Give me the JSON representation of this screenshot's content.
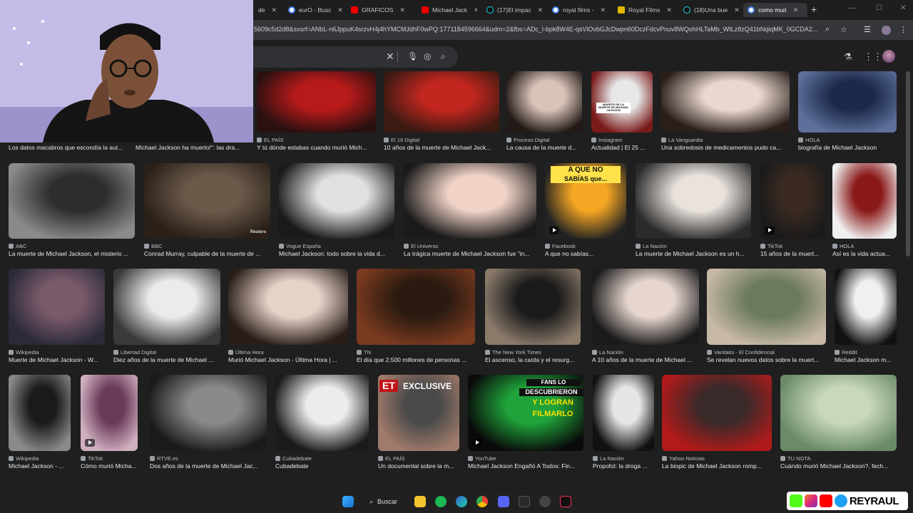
{
  "tabs": [
    {
      "label": "de",
      "color": "#c00"
    },
    {
      "label": "eurO - Busc",
      "color": "#4285f4"
    },
    {
      "label": "GRAFICOS",
      "color": "#e00"
    },
    {
      "label": "Michael Jack",
      "color": "#e00"
    },
    {
      "label": "(17)El impac",
      "color": "#111"
    },
    {
      "label": "royal films -",
      "color": "#4285f4"
    },
    {
      "label": "Royal Films",
      "color": "#e0b800"
    },
    {
      "label": "(18)Una bue",
      "color": "#111"
    },
    {
      "label": "como muri",
      "color": "#4285f4"
    }
  ],
  "address": {
    "url": "5609c5d2d8&sxsrf=ANbL-n6JppuK4srzvH4j4hYMCMJdhF0wPQ:1771184596664&udm=2&fbs=ADc_l-bpk8W4E-qsVlOvbGJcDwpn60DczFdcvPnuv8WQohHLTaMb_WtLz8zQ41bNqiqMK_0GCDA2..."
  },
  "results": [
    {
      "source": "",
      "title": "Los datos macabros que escondía la aut...",
      "colors": [
        "#2a2a2a",
        "#3a3a3a"
      ]
    },
    {
      "source": "",
      "title": "Michael Jackson ha muerto!\": las dra...",
      "colors": [
        "#333",
        "#555"
      ]
    },
    {
      "source": "EL PAÍS",
      "title": "Y tú dónde estabas cuando murió Mich...",
      "colors": [
        "#b81a1a",
        "#2a1010"
      ]
    },
    {
      "source": "El 19 Digital",
      "title": "10 años de la muerte de Michael Jack...",
      "colors": [
        "#c2261f",
        "#3b1a12"
      ]
    },
    {
      "source": "Proceso Digital",
      "title": "La causa de la muerte d...",
      "colors": [
        "#d9c3b8",
        "#231a18"
      ]
    },
    {
      "source": "Instagram",
      "title": "Actualidad | El 25 ...",
      "colors": [
        "#e8e8e8",
        "#7a1a1a"
      ]
    },
    {
      "source": "La Vanguardia",
      "title": "Una sobredosis de medicamentos pudo ca...",
      "colors": [
        "#e9d8cf",
        "#2a1e1a"
      ]
    },
    {
      "source": "HOLA",
      "title": "biografía de Michael Jackson",
      "colors": [
        "#1c2a4a",
        "#5d6f9a"
      ]
    },
    {
      "source": "ABC",
      "title": "La muerte de Michael Jackson, el misterio ...",
      "colors": [
        "#2d2d2d",
        "#8a8a8a"
      ]
    },
    {
      "source": "BBC",
      "title": "Conrad Murray, culpable de la muerte de ...",
      "colors": [
        "#6b5a4a",
        "#2a2018"
      ]
    },
    {
      "source": "Vogue España",
      "title": "Michael Jackson: todo sobre la vida d...",
      "colors": [
        "#e0e0e0",
        "#1a1a1a"
      ]
    },
    {
      "source": "El Universo",
      "title": "La trágica muerte de Michael Jackson fue \"in...",
      "colors": [
        "#f0d2c6",
        "#1a1a1a"
      ]
    },
    {
      "source": "Facebook",
      "title": "A que no sabías...",
      "colors": [
        "#f5a623",
        "#222"
      ],
      "play": true
    },
    {
      "source": "La Nación",
      "title": "La muerte de Michael Jackson es un h...",
      "colors": [
        "#e9e2dd",
        "#2a2a2a"
      ]
    },
    {
      "source": "TikTok",
      "title": "15 años de la muert...",
      "colors": [
        "#3a2a22",
        "#1a1a1a"
      ],
      "play": true
    },
    {
      "source": "HOLA",
      "title": "Así es la vida actua...",
      "colors": [
        "#8a1a1a",
        "#f0f0f0"
      ]
    },
    {
      "source": "Wikipedia",
      "title": "Muerte de Michael Jackson - W...",
      "colors": [
        "#7a5a6a",
        "#2a2a3a"
      ]
    },
    {
      "source": "Libertad Digital",
      "title": "Diez años de la muerte de Michael ...",
      "colors": [
        "#ebebeb",
        "#3a3a3a"
      ]
    },
    {
      "source": "Última Hora",
      "title": "Murió Michael Jackson - Última Hora | ...",
      "colors": [
        "#e5d3c8",
        "#2a1d18"
      ]
    },
    {
      "source": "TN",
      "title": "El día que 2.500 millones de personas ...",
      "colors": [
        "#2a1a10",
        "#7a3a20"
      ]
    },
    {
      "source": "The New York Times",
      "title": "El ascenso, la caída y el resurg...",
      "colors": [
        "#1a1a1a",
        "#8a7a6a"
      ]
    },
    {
      "source": "La Nación",
      "title": "A 10 años de la muerte de Michael ...",
      "colors": [
        "#e6d6cf",
        "#1a1a1a"
      ]
    },
    {
      "source": "Vanitatis - El Confidencial",
      "title": "Se revelan nuevos datos sobre la muert...",
      "colors": [
        "#6a7a5a",
        "#c8b8a8"
      ]
    },
    {
      "source": "Reddit",
      "title": "Michael Jackson m...",
      "colors": [
        "#f0f0f0",
        "#111"
      ]
    },
    {
      "source": "Wikipedia",
      "title": "Michael Jackson - ...",
      "colors": [
        "#1a1a1a",
        "#8a8a8a"
      ]
    },
    {
      "source": "TikTok",
      "title": "Cómo murió Micha...",
      "colors": [
        "#6a3a5a",
        "#d0b0c0"
      ],
      "play": true
    },
    {
      "source": "RTVE.es",
      "title": "Dos años de la muerte de Michael Jac...",
      "colors": [
        "#8a8a8a",
        "#1a1a1a"
      ]
    },
    {
      "source": "Cubadebate",
      "title": "Cubadebate",
      "colors": [
        "#ececec",
        "#1a1a1a"
      ]
    },
    {
      "source": "EL PAÍS",
      "title": "Un documental sobre la m...",
      "colors": [
        "#4a4a4a",
        "#a07a6a"
      ]
    },
    {
      "source": "YouTube",
      "title": "Michael Jackson Engañó A Todos: Fin...",
      "colors": [
        "#1fa33a",
        "#0a0a0a"
      ],
      "play": true
    },
    {
      "source": "La Nación",
      "title": "Propofol: la droga ...",
      "colors": [
        "#e6e6e6",
        "#111"
      ]
    },
    {
      "source": "Yahoo Noticias",
      "title": "La biopic de Michael Jackson romp...",
      "colors": [
        "#3a2a2a",
        "#b01a1a"
      ]
    },
    {
      "source": "TU NOTA",
      "title": "Cuándo murió Michael Jackson?, fech...",
      "colors": [
        "#c8d8b8",
        "#6a8a6a"
      ]
    }
  ],
  "overlays": {
    "asabias_line1": "A QUE NO",
    "asabias_line2": "SABÍAS que...",
    "et_badge": "ET",
    "et_exclusive": "EXCLUSIVE",
    "fans_l1": "FANS LO",
    "fans_l2": "DESCUBRIERON",
    "fans_l3": "Y LOGRAN",
    "fans_l4": "FILMARLO",
    "reuters": "Reuters",
    "instagram_box": "MUERTE DE LA MUERTE DE MICHAEL JACKSON"
  },
  "taskbar": {
    "search_label": "Buscar"
  },
  "brand": {
    "name": "REYRAUL"
  }
}
